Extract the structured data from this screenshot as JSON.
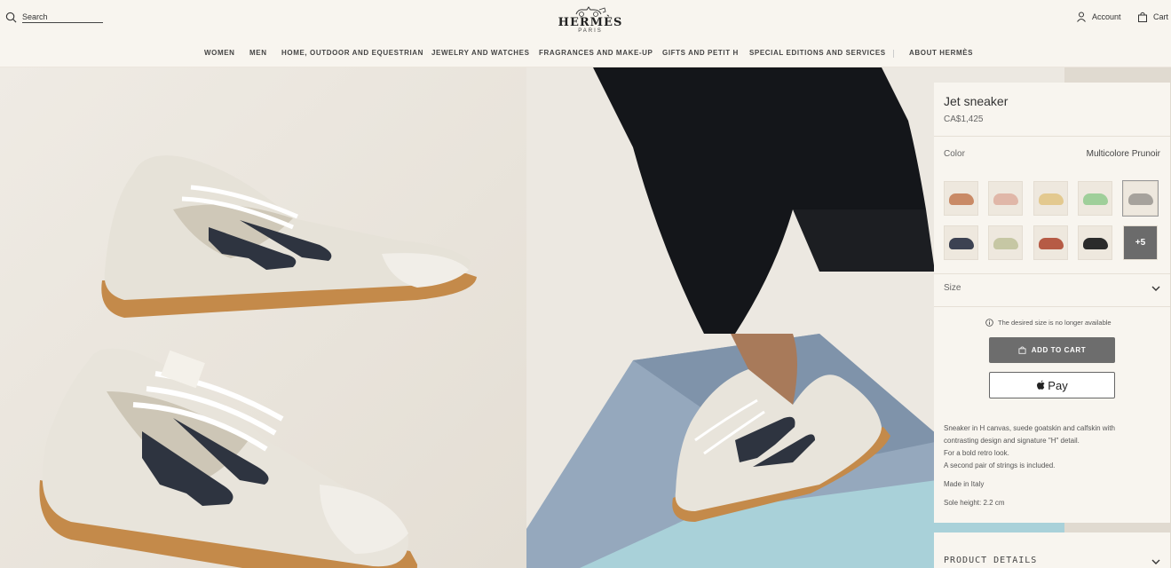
{
  "header": {
    "search_placeholder": "Search",
    "logo_text": "HERMÈS",
    "logo_sub": "PARIS",
    "account_label": "Account",
    "cart_label": "Cart"
  },
  "nav": {
    "items": [
      "WOMEN",
      "MEN",
      "HOME, OUTDOOR AND EQUESTRIAN",
      "JEWELRY AND WATCHES",
      "FRAGRANCES AND MAKE-UP",
      "GIFTS AND PETIT H",
      "SPECIAL EDITIONS AND SERVICES",
      "ABOUT HERMÈS"
    ]
  },
  "product": {
    "title": "Jet sneaker",
    "price": "CA$1,425",
    "color_label": "Color",
    "color_value": "Multicolore Prunoir",
    "more_swatches": "+5",
    "swatch_colors": [
      "#c98a66",
      "#e0b7a8",
      "#e3c98f",
      "#9fcf9a",
      "#a6a29c",
      "#3c4252",
      "#c6c7a4",
      "#b65b45",
      "#2b2b2b"
    ],
    "size_label": "Size",
    "unavailable_text": "The desired size is no longer available",
    "add_to_cart": "ADD TO CART",
    "pay_label": "Pay",
    "description": [
      "Sneaker in H canvas, suede goatskin and calfskin with",
      "contrasting design and signature \"H\" detail.",
      "For a bold retro look.",
      "A second pair of strings is included."
    ],
    "made_in": "Made in Italy",
    "sole_height": "Sole height: 2.2 cm",
    "details_label": "PRODUCT DETAILS"
  },
  "colors": {
    "accent_button": "#6d6d6d",
    "background": "#f8f5ef",
    "sole": "#c48a4a",
    "shoe_base": "#ece9e2",
    "h_logo": "#2e3440"
  }
}
